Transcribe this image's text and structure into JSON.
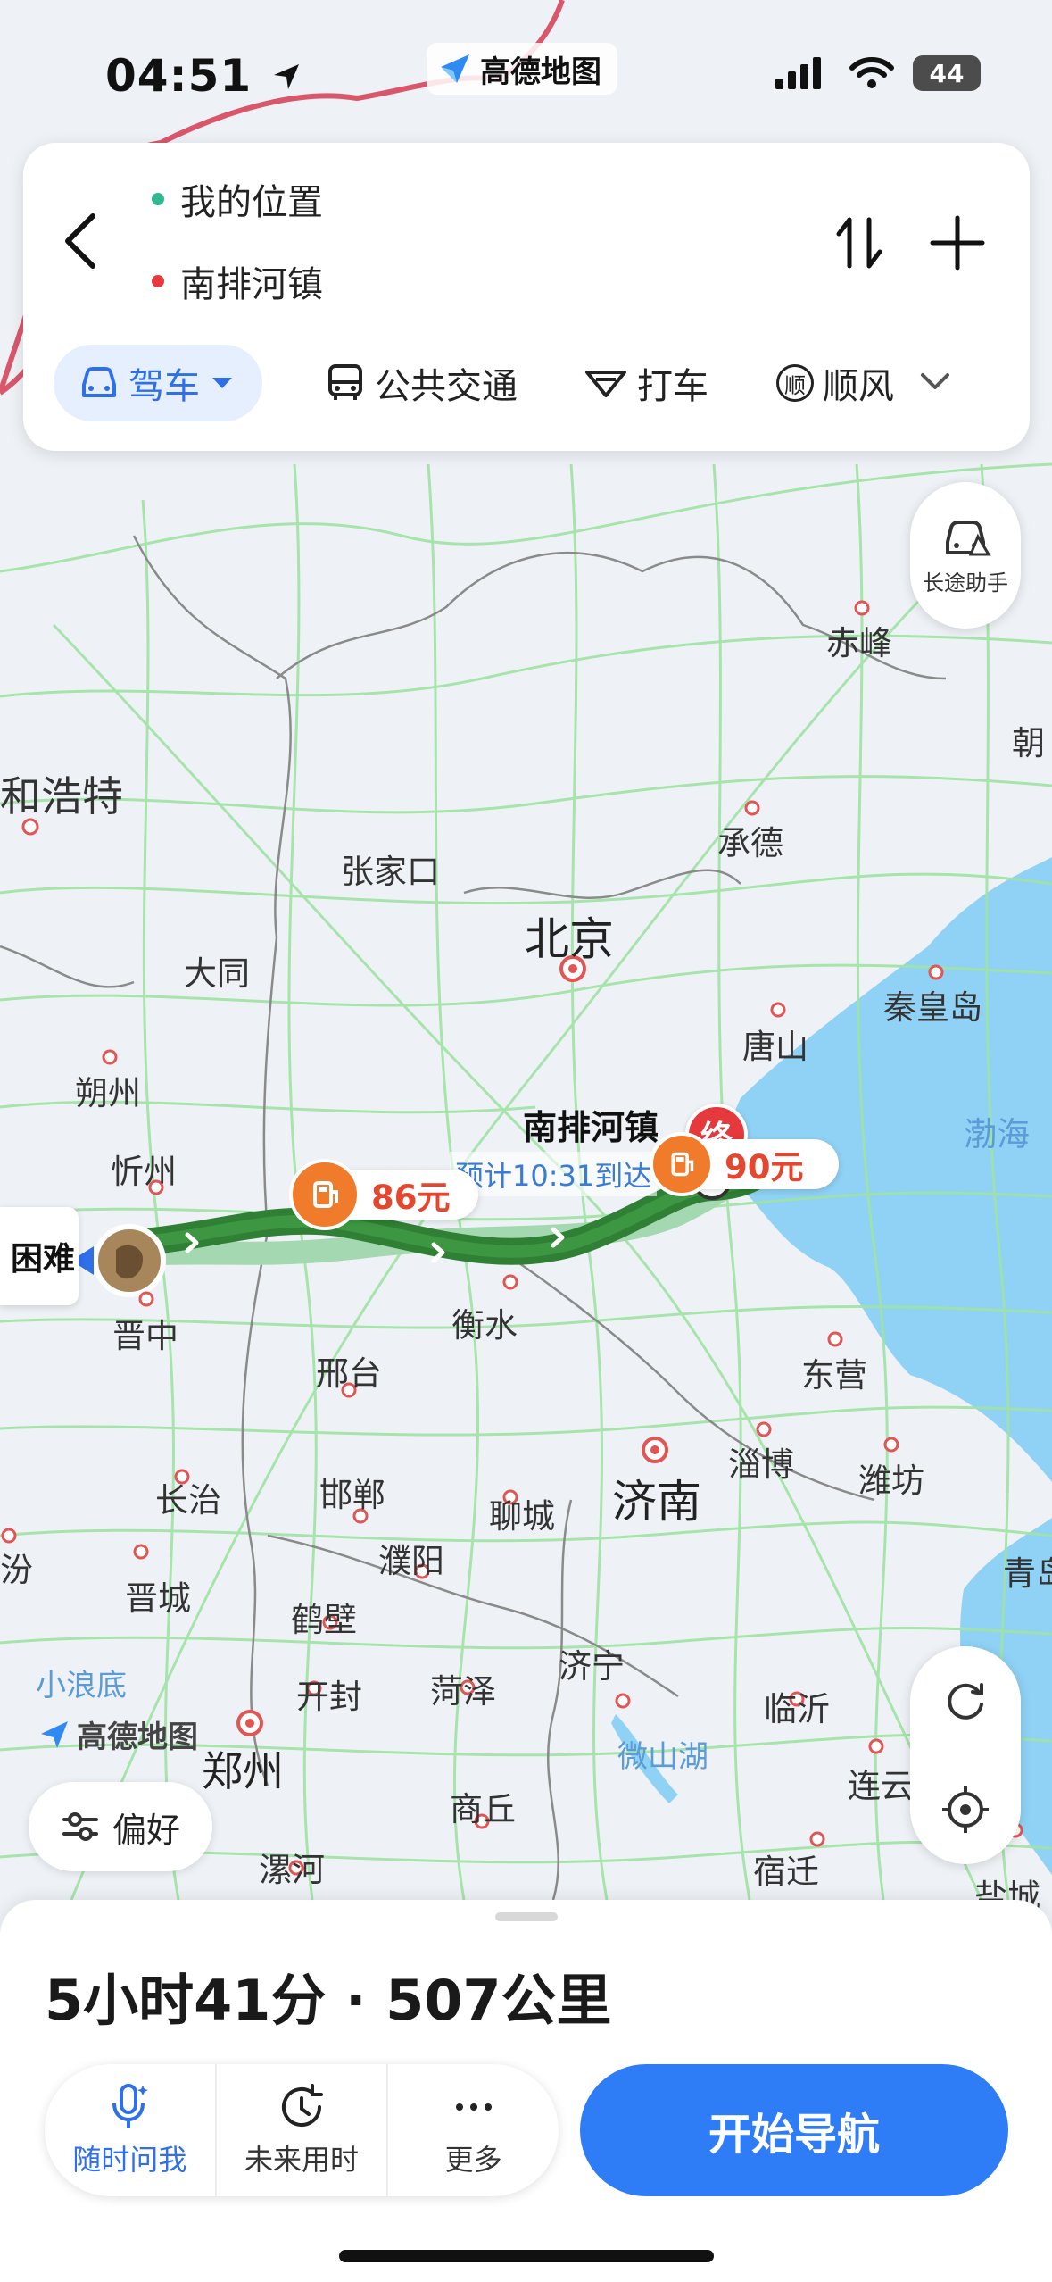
{
  "status_bar": {
    "time": "04:51",
    "app_name": "高德地图",
    "battery": "44"
  },
  "route_card": {
    "origin": "我的位置",
    "destination": "南排河镇",
    "modes": [
      {
        "label": "驾车",
        "active": true
      },
      {
        "label": "公共交通",
        "active": false
      },
      {
        "label": "打车",
        "active": false
      },
      {
        "label": "顺风",
        "active": false
      }
    ]
  },
  "map": {
    "long_trip_assistant": "长途助手",
    "destination_name": "南排河镇",
    "destination_badge": "终",
    "eta": "预计10:31到达",
    "toll_1": "86元",
    "toll_2": "90元",
    "origin_partial": "困难",
    "preference_label": "偏好",
    "watermark": "高德地图",
    "cities": {
      "hohhot": "和浩特",
      "chifeng": "赤峰",
      "chao": "朝",
      "chengde": "承德",
      "zhangjiakou": "张家口",
      "beijing": "北京",
      "datong": "大同",
      "qinhuangdao": "秦皇岛",
      "tangshan": "唐山",
      "shuozhou": "朔州",
      "xinzhou": "忻州",
      "bohai": "渤海",
      "jinzhong": "晋中",
      "hengshui": "衡水",
      "xingtai": "邢台",
      "dongying": "东营",
      "zibo": "淄博",
      "weifang": "潍坊",
      "jinan": "济南",
      "changzhi": "长治",
      "handan": "邯郸",
      "liaocheng": "聊城",
      "fen": "汾",
      "puyang": "濮阳",
      "qing": "青岛",
      "jincheng": "晋城",
      "hebi": "鹤壁",
      "jining": "济宁",
      "linyi": "临沂",
      "xiaolangdi": "小浪底",
      "kaifeng": "开封",
      "heze": "菏泽",
      "zhengzhou": "郑州",
      "weishanhu": "微山湖",
      "lianyun": "连云",
      "shangqiu": "商丘",
      "luohe": "漯河",
      "suqian": "宿迁",
      "yancheng": "盐城"
    }
  },
  "bottom_panel": {
    "summary": "5小时41分 · 507公里",
    "actions": [
      {
        "label": "随时问我"
      },
      {
        "label": "未来用时"
      },
      {
        "label": "更多"
      }
    ],
    "start_button": "开始导航"
  },
  "colors": {
    "accent": "#2e7cf6",
    "route": "#3a8a3a",
    "destination": "#e5393d",
    "toll": "#f07b2a",
    "sea": "#8fd2f5"
  }
}
